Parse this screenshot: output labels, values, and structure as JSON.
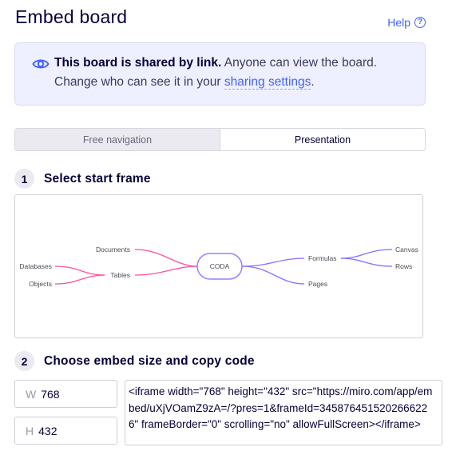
{
  "header": {
    "title": "Embed board",
    "help_label": "Help"
  },
  "notice": {
    "bold_text": "This board is shared by link.",
    "rest_text": " Anyone can view the board.",
    "line2_text": "Change who can see it in your ",
    "link_text": "sharing settings",
    "trailing": "."
  },
  "mode_tabs": [
    {
      "label": "Free navigation",
      "selected": false
    },
    {
      "label": "Presentation",
      "selected": true
    }
  ],
  "step1": {
    "number": "1",
    "label": "Select start frame"
  },
  "mindmap": {
    "center": "CODA",
    "left": [
      "Documents",
      "Tables",
      "Databases",
      "Objects"
    ],
    "right": [
      "Formulas",
      "Pages",
      "Canvas",
      "Rows"
    ],
    "colors": {
      "left_branch": "#ff4fa0",
      "right_branch": "#8f6bff",
      "center_border": "#9b7dff"
    }
  },
  "step2": {
    "number": "2",
    "label": "Choose embed size and copy code"
  },
  "size": {
    "width_prefix": "W",
    "width_value": "768",
    "height_prefix": "H",
    "height_value": "432"
  },
  "embed_code": "<iframe width=\"768\" height=\"432\" src=\"https://miro.com/app/embed/uXjVOamZ9zA=/?pres=1&frameId=3458764515202666226\" frameBorder=\"0\" scrolling=\"no\" allowFullScreen></iframe>"
}
